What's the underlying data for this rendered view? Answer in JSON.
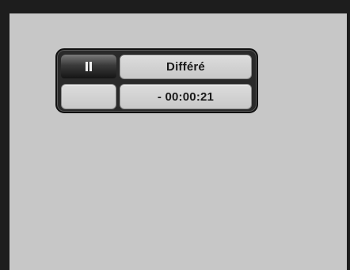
{
  "osd": {
    "playback_state_icon": "pause-icon",
    "mode_label": "Différé",
    "time_offset": "- 00:00:21"
  }
}
